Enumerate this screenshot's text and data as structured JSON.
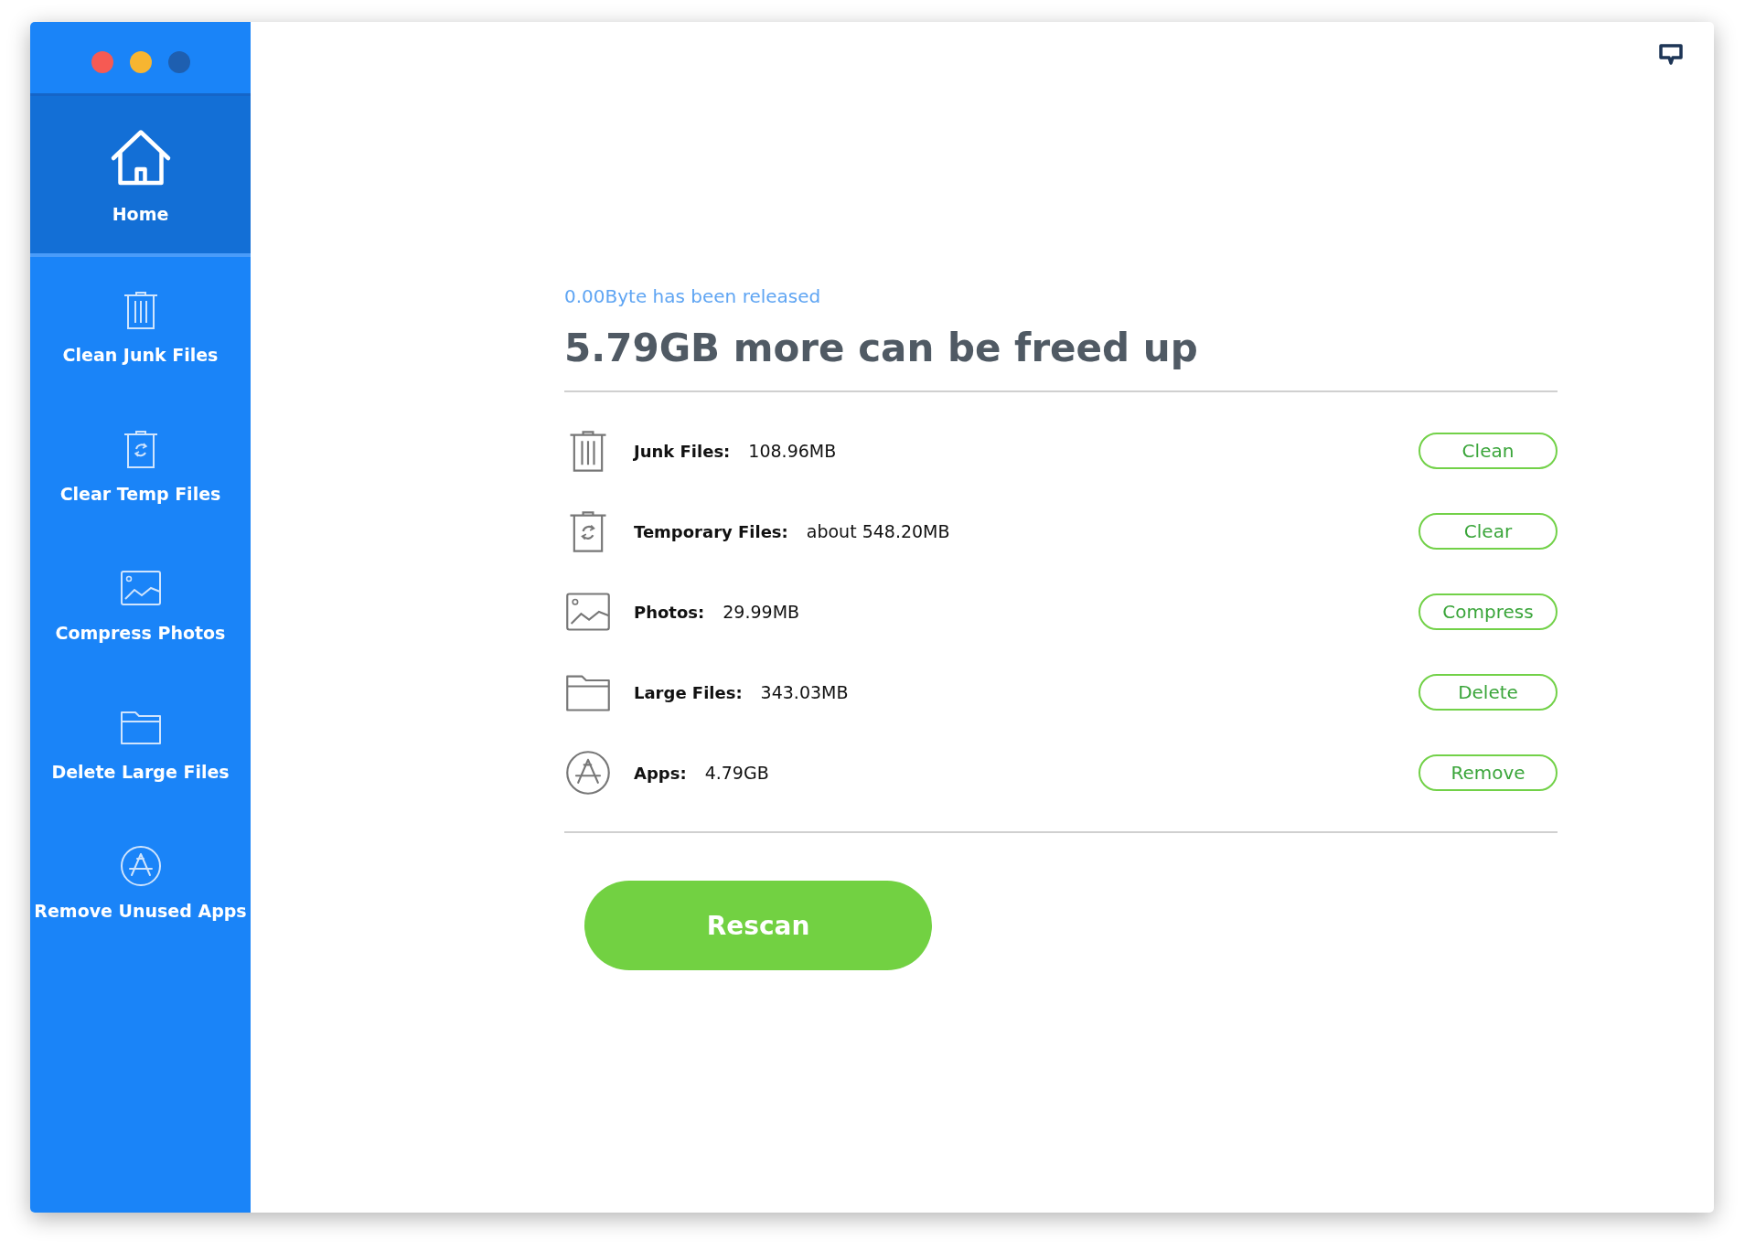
{
  "sidebar": {
    "items": [
      {
        "kind": "home",
        "label": "Home",
        "selected": true
      },
      {
        "kind": "trash",
        "label": "Clean Junk Files",
        "selected": false
      },
      {
        "kind": "recycle",
        "label": "Clear Temp Files",
        "selected": false
      },
      {
        "kind": "photo",
        "label": "Compress Photos",
        "selected": false
      },
      {
        "kind": "folder",
        "label": "Delete Large Files",
        "selected": false
      },
      {
        "kind": "apps",
        "label": "Remove Unused Apps",
        "selected": false
      }
    ]
  },
  "status": "0.00Byte has been released",
  "headline": "5.79GB more can be freed up",
  "rows": [
    {
      "kind": "trash",
      "label": "Junk Files:",
      "value": "108.96MB",
      "action": "Clean"
    },
    {
      "kind": "recycle",
      "label": "Temporary Files:",
      "value": "about 548.20MB",
      "action": "Clear"
    },
    {
      "kind": "photo",
      "label": "Photos:",
      "value": "29.99MB",
      "action": "Compress"
    },
    {
      "kind": "folder",
      "label": "Large Files:",
      "value": "343.03MB",
      "action": "Delete"
    },
    {
      "kind": "apps",
      "label": "Apps:",
      "value": "4.79GB",
      "action": "Remove"
    }
  ],
  "rescan": "Rescan"
}
